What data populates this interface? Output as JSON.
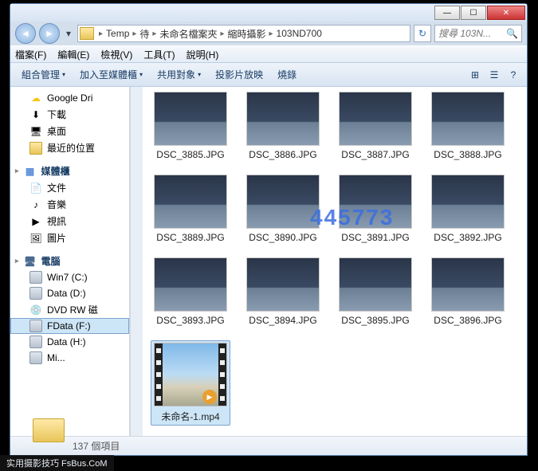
{
  "window": {
    "min": "—",
    "max": "☐",
    "close": "✕"
  },
  "nav": {
    "back_glyph": "◄",
    "fwd_glyph": "►",
    "drop_glyph": "▾"
  },
  "breadcrumb": {
    "items": [
      "Temp",
      "待",
      "未命名檔案夾",
      "縮時攝影",
      "103ND700"
    ],
    "sep": "▸"
  },
  "refresh_glyph": "↻",
  "search": {
    "placeholder": "搜尋 103N...",
    "glyph": "🔍"
  },
  "menubar": {
    "file": "檔案(F)",
    "edit": "編輯(E)",
    "view": "檢視(V)",
    "tools": "工具(T)",
    "help": "說明(H)"
  },
  "toolbar": {
    "organize": "組合管理",
    "include": "加入至媒體櫃",
    "share": "共用對象",
    "slideshow": "投影片放映",
    "burn": "燒錄",
    "preview_glyph": "⊞",
    "view_glyph": "☰",
    "help_glyph": "?"
  },
  "navpane": {
    "favorites": {
      "head": "",
      "items": [
        {
          "name": "Google Dri",
          "ico": "☁"
        },
        {
          "name": "下載",
          "ico": "⬇"
        },
        {
          "name": "桌面",
          "ico": "🖥"
        },
        {
          "name": "最近的位置",
          "ico": "📁"
        }
      ]
    },
    "libraries": {
      "head": "媒體櫃",
      "items": [
        {
          "name": "文件",
          "ico": "📄"
        },
        {
          "name": "音樂",
          "ico": "♪"
        },
        {
          "name": "視訊",
          "ico": "▶"
        },
        {
          "name": "圖片",
          "ico": "🖼"
        }
      ]
    },
    "computer": {
      "head": "電腦",
      "items": [
        {
          "name": "Win7 (C:)",
          "ico": "💽"
        },
        {
          "name": "Data (D:)",
          "ico": "💽"
        },
        {
          "name": "DVD RW 磁",
          "ico": "💿"
        },
        {
          "name": "FData (F:)",
          "ico": "💽",
          "selected": true
        },
        {
          "name": "Data (H:)",
          "ico": "💽"
        },
        {
          "name": "Mi...",
          "ico": "💽"
        }
      ]
    }
  },
  "files": {
    "images": [
      "DSC_3885.JPG",
      "DSC_3886.JPG",
      "DSC_3887.JPG",
      "DSC_3888.JPG",
      "DSC_3889.JPG",
      "DSC_3890.JPG",
      "DSC_3891.JPG",
      "DSC_3892.JPG",
      "DSC_3893.JPG",
      "DSC_3894.JPG",
      "DSC_3895.JPG",
      "DSC_3896.JPG"
    ],
    "video": {
      "name": "未命名-1.mp4",
      "selected": true
    }
  },
  "status": {
    "count": "137 個項目"
  },
  "watermark_center": "445773",
  "watermark_bottom": "实用摄影技巧 FsBus.CoM"
}
